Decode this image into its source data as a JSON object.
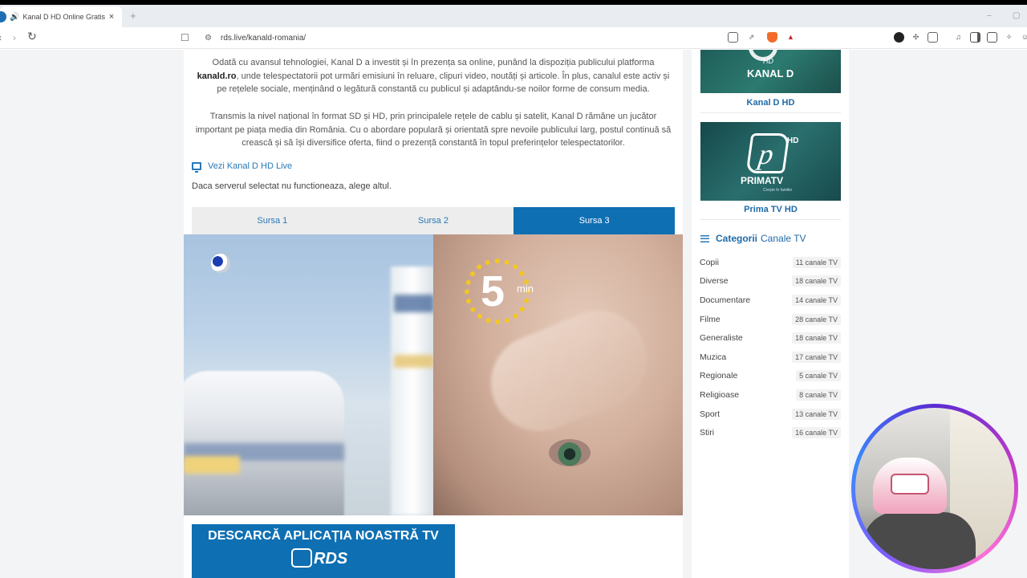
{
  "browser": {
    "tab_title": "Kanal D HD Online Gratis - RDS",
    "tab_close": "×",
    "new_tab": "+",
    "url": "rds.live/kanald-romania/",
    "min": "–",
    "max": "▢",
    "back": "‹",
    "forward": "›",
    "reload": "↻"
  },
  "content": {
    "paragraph1_a": "Odată cu avansul tehnologiei, Kanal D a investit și în prezența sa online, punând la dispoziția publicului platforma ",
    "paragraph1_bold": "kanald.ro",
    "paragraph1_b": ", unde telespectatorii pot urmări emisiuni în reluare, clipuri video, noutăți și articole. În plus, canalul este activ și pe rețelele sociale, menținând o legătură constantă cu publicul și adaptându-se noilor forme de consum media.",
    "paragraph2": "Transmis la nivel național în format SD și HD, prin principalele rețele de cablu și satelit, Kanal D rămâne un jucător important pe piața media din România. Cu o abordare populară și orientată spre nevoile publicului larg, postul continuă să crească și să își diversifice oferta, fiind o prezență constantă în topul preferințelor telespectatorilor.",
    "live_link": "Vezi Kanal D HD Live",
    "server_note": "Daca serverul selectat nu functioneaza, alege altul.",
    "sources": [
      "Sursa 1",
      "Sursa 2",
      "Sursa 3"
    ],
    "active_source": "Sursa 3",
    "ad_timer_value": "5",
    "ad_timer_unit": "min",
    "banner_title": "DESCARCĂ APLICAȚIA NOASTRĂ TV",
    "banner_brand": "RDS"
  },
  "sidebar": {
    "kanald_label": "Kanal D HD",
    "kanald_logo": "KANAL D",
    "kanald_hd": "HD",
    "prima_label": "Prima TV HD",
    "prima_logo": "PRIMATV",
    "prima_hd": "HD",
    "prima_p": "p",
    "prima_tag": "Crește în familie",
    "categories_title_bold": "Categorii",
    "categories_title_rest": "Canale TV",
    "categories": [
      {
        "name": "Copii",
        "count": "11 canale TV"
      },
      {
        "name": "Diverse",
        "count": "18 canale TV"
      },
      {
        "name": "Documentare",
        "count": "14 canale TV"
      },
      {
        "name": "Filme",
        "count": "28 canale TV"
      },
      {
        "name": "Generaliste",
        "count": "18 canale TV"
      },
      {
        "name": "Muzica",
        "count": "17 canale TV"
      },
      {
        "name": "Regionale",
        "count": "5 canale TV"
      },
      {
        "name": "Religioase",
        "count": "8 canale TV"
      },
      {
        "name": "Sport",
        "count": "13 canale TV"
      },
      {
        "name": "Stiri",
        "count": "16 canale TV"
      }
    ]
  },
  "colors": {
    "brand_blue": "#0e6fb3",
    "link_blue": "#2778b8",
    "timer_yellow": "#f3c624"
  }
}
